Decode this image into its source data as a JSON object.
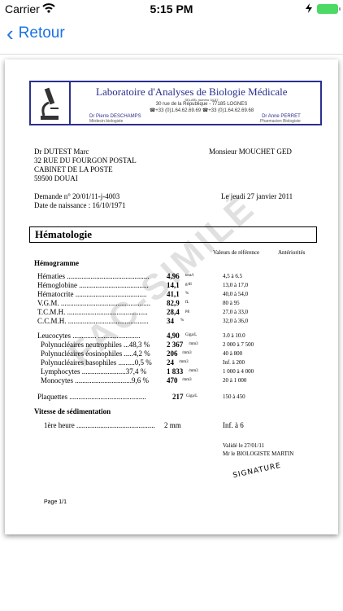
{
  "status_bar": {
    "carrier": "Carrier",
    "time": "5:15 PM"
  },
  "nav": {
    "back_label": "Retour"
  },
  "header": {
    "lab_title": "Laboratoire d'Analyses de Biologie Médicale",
    "selarl": "SELARL numéro 34-87",
    "address": "30 rue de la République - 77185 LOGNES",
    "phone": "☎+33 (0)1.64.62.69.69 ☎+33 (0)1.64.62.69.68",
    "doctor1_name": "Dr Pierre DESCHAMPS",
    "doctor1_role": "Médecin biologiste",
    "doctor2_name": "Dr Anne PERRET",
    "doctor2_role": "Pharmacien Biologiste"
  },
  "patient": {
    "name": "Dr  DUTEST Marc",
    "address1": "32 RUE DU FOURGON POSTAL",
    "address2": "CABINET DE LA POSTE",
    "address3": "59500 DOUAI",
    "recipient": "Monsieur MOUCHET GED",
    "request": "Demande n° 20/01/11-j-4003",
    "birth": "Date de naissance : 16/10/1971",
    "date": "Le jeudi 27 janvier 2011"
  },
  "section_title": "Hématologie",
  "columns": {
    "ref": "Valeurs de référence",
    "prev": "Antériorités"
  },
  "subsection1": "Hémogramme",
  "rows": [
    {
      "label": "Hématies .............................................",
      "value": "4,96",
      "unit": "tera/l",
      "ref": "4,5 à 6.5"
    },
    {
      "label": "Hémoglobine ......................................",
      "value": "14,1",
      "unit": "g/dl",
      "ref": "13,0 à 17,0"
    },
    {
      "label": "Hématocrite .......................................",
      "value": "41,1",
      "unit": "%",
      "ref": "40,0 à 54,0"
    },
    {
      "label": "V.G.M. .................................................",
      "value": "82,9",
      "unit": "fL",
      "ref": "80 à 95"
    },
    {
      "label": "T.C.M.H. ............................................",
      "value": "28,4",
      "unit": "pg",
      "ref": "27,0 à 33,0"
    },
    {
      "label": "C.C.M.H. ............................................",
      "value": "34",
      "unit": "%",
      "ref": "32,0 à 36,0"
    },
    {
      "label": "Leucocytes ............. .......................",
      "value": "4,90",
      "unit": "Giga/L",
      "ref": "3.0 à 10.0"
    },
    {
      "label": "Polynucléaires neutrophiles ...48,3 %",
      "value": "2 367",
      "unit": "/mm3",
      "ref": "2 000 à 7 500"
    },
    {
      "label": "Polynucléaires éosinophiles .....4,2 %",
      "value": "206",
      "unit": "/mm3",
      "ref": "40 à 800"
    },
    {
      "label": "Polynucléaires basophiles .........0,5 %",
      "value": "24",
      "unit": "/mm3",
      "ref": "Inf. à 200"
    },
    {
      "label": "Lymphocytes ........................37,4 %",
      "value": "1 833",
      "unit": "/mm3",
      "ref": "1 000 à 4 000"
    },
    {
      "label": "Monocytes ...............................9,6 %",
      "value": "470",
      "unit": "/mm3",
      "ref": "20 à 1 000"
    },
    {
      "label": "Plaquettes ..........................................",
      "value": "217",
      "unit": "Giga/L",
      "ref": "150 à 450"
    }
  ],
  "subsection2": "Vitesse de sédimentation",
  "vs": {
    "label": "1ère heure ...........................................",
    "value": "2 mm",
    "ref": "Inf. à 6"
  },
  "validation": {
    "line1": "Validé le 27/01/11",
    "line2": "Mr le BIOLOGISTE MARTIN"
  },
  "watermark": "FAC-SIMILÉ",
  "signature": "SIGNATURE",
  "page_number": "Page 1/1"
}
